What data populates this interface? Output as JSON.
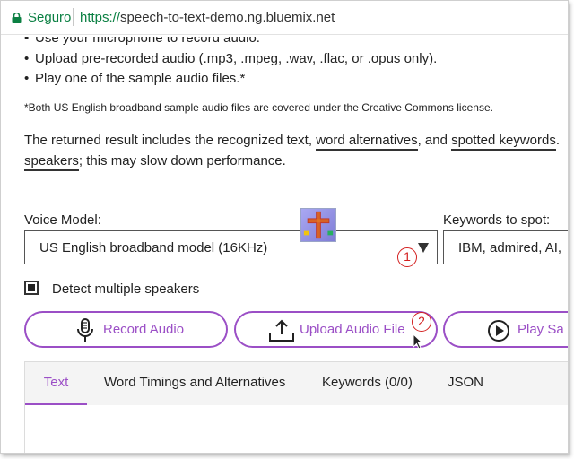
{
  "browser": {
    "secure_label": "Seguro",
    "url_scheme": "https://",
    "url_host": "speech-to-text-demo.ng.bluemix.net"
  },
  "intro": {
    "bullets": [
      "Use your microphone to record audio.",
      "Upload pre-recorded audio (.mp3, .mpeg, .wav, .flac, or .opus only).",
      "Play one of the sample audio files.*"
    ],
    "license_note": "*Both US English broadband sample audio files are covered under the Creative Commons license.",
    "result_text_before": "The returned result includes the recognized text, ",
    "word_alternatives_link": "word alternatives",
    "result_text_middle": ", and ",
    "spotted_keywords_link": "spotted keywords",
    "result_text_end": ".",
    "speakers_link": "speakers",
    "result_text_line2": "; this may slow down performance."
  },
  "form": {
    "voice_model_label": "Voice Model:",
    "voice_model_value": "US English broadband model (16KHz)",
    "keywords_label": "Keywords to spot:",
    "keywords_value": "IBM, admired, AI, "
  },
  "detect_speakers": {
    "label": "Detect multiple speakers",
    "checked": true
  },
  "buttons": {
    "record": "Record Audio",
    "upload": "Upload Audio File",
    "play": "Play Sa"
  },
  "annotations": {
    "marker_1": "1",
    "marker_2": "2"
  },
  "tabs": {
    "text": "Text",
    "timings": "Word Timings and Alternatives",
    "keywords": "Keywords (0/0)",
    "json": "JSON"
  },
  "colors": {
    "accent": "#9b4fc6",
    "secure_green": "#0b8043",
    "marker_red": "#d32020"
  },
  "icons": [
    "lock-icon",
    "microphone-icon",
    "upload-icon",
    "play-circle-icon",
    "dropdown-arrow-icon",
    "mouse-cursor-icon"
  ]
}
